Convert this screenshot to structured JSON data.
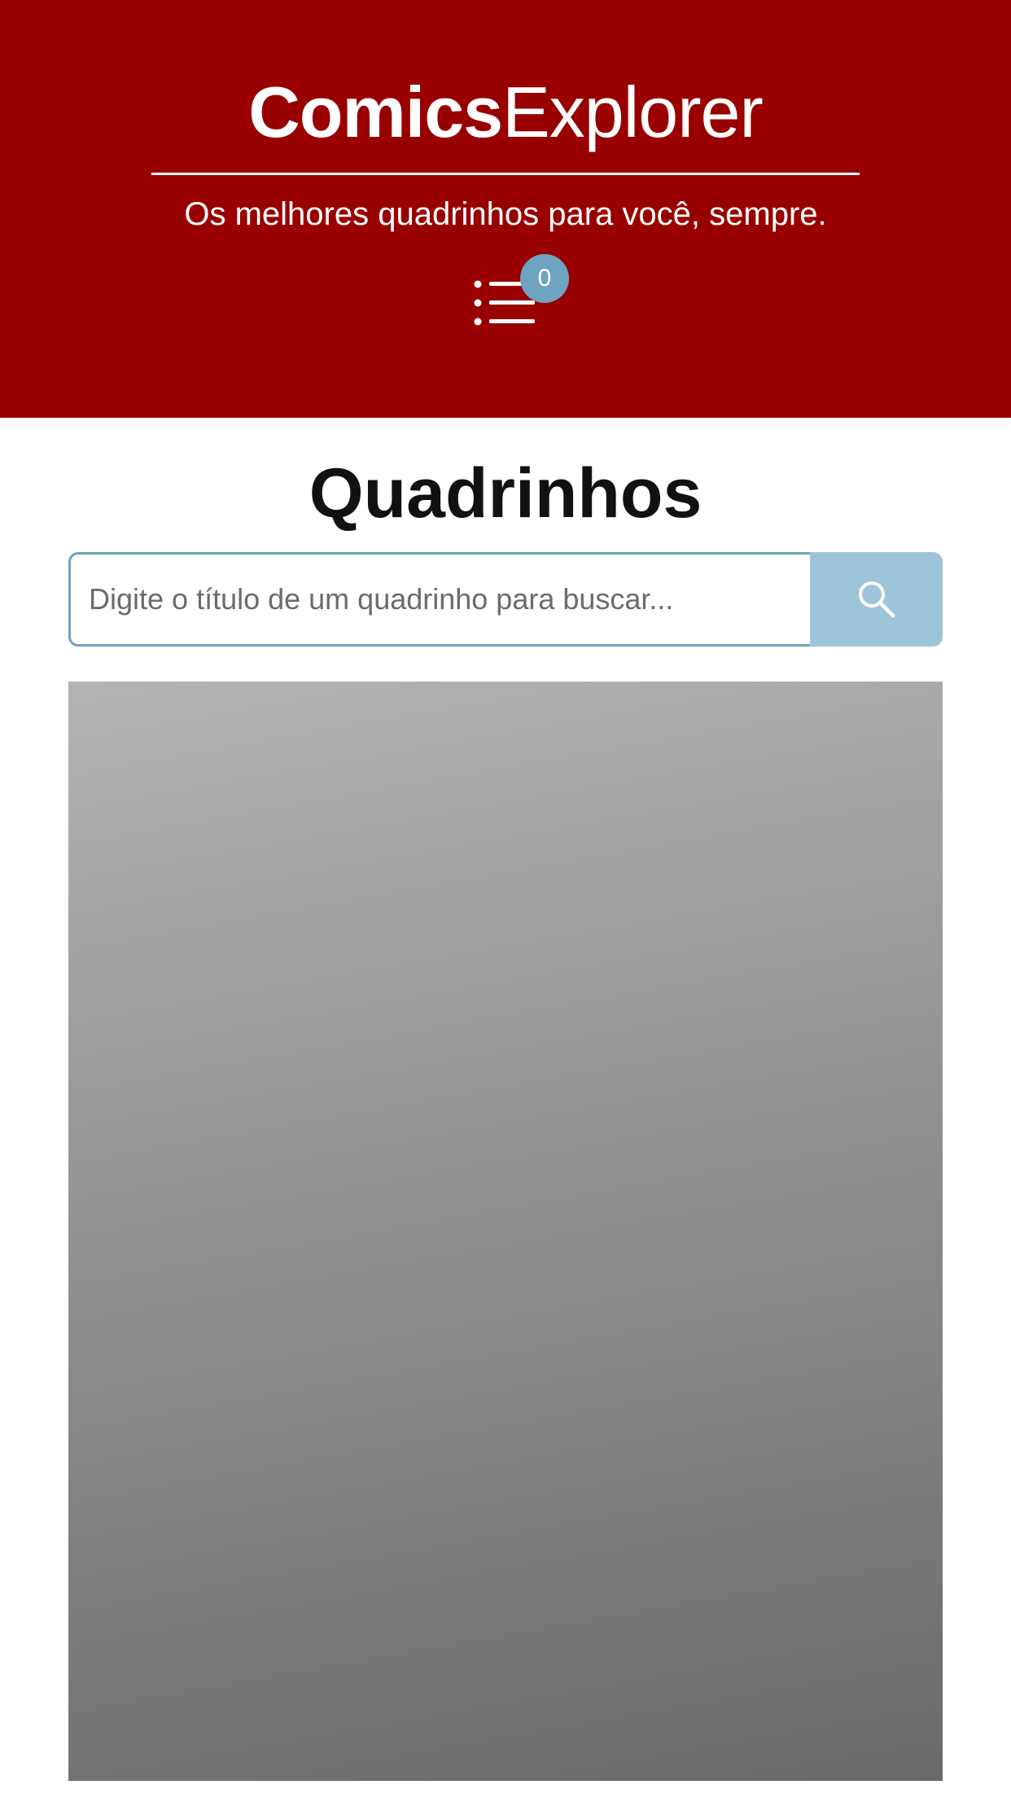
{
  "header": {
    "logo_bold": "Comics",
    "logo_light": "Explorer",
    "tagline": "Os melhores quadrinhos para você, sempre.",
    "menu_icon": "list-icon",
    "cart_count": "0",
    "background_color": "#990000",
    "badge_color": "#6fa3c2"
  },
  "main": {
    "title": "Quadrinhos",
    "search": {
      "placeholder": "Digite o título de um quadrinho para buscar...",
      "value": "",
      "button_icon": "search-icon",
      "button_color": "#9dc4d8"
    },
    "comic_card": {
      "image": "image-placeholder"
    }
  }
}
